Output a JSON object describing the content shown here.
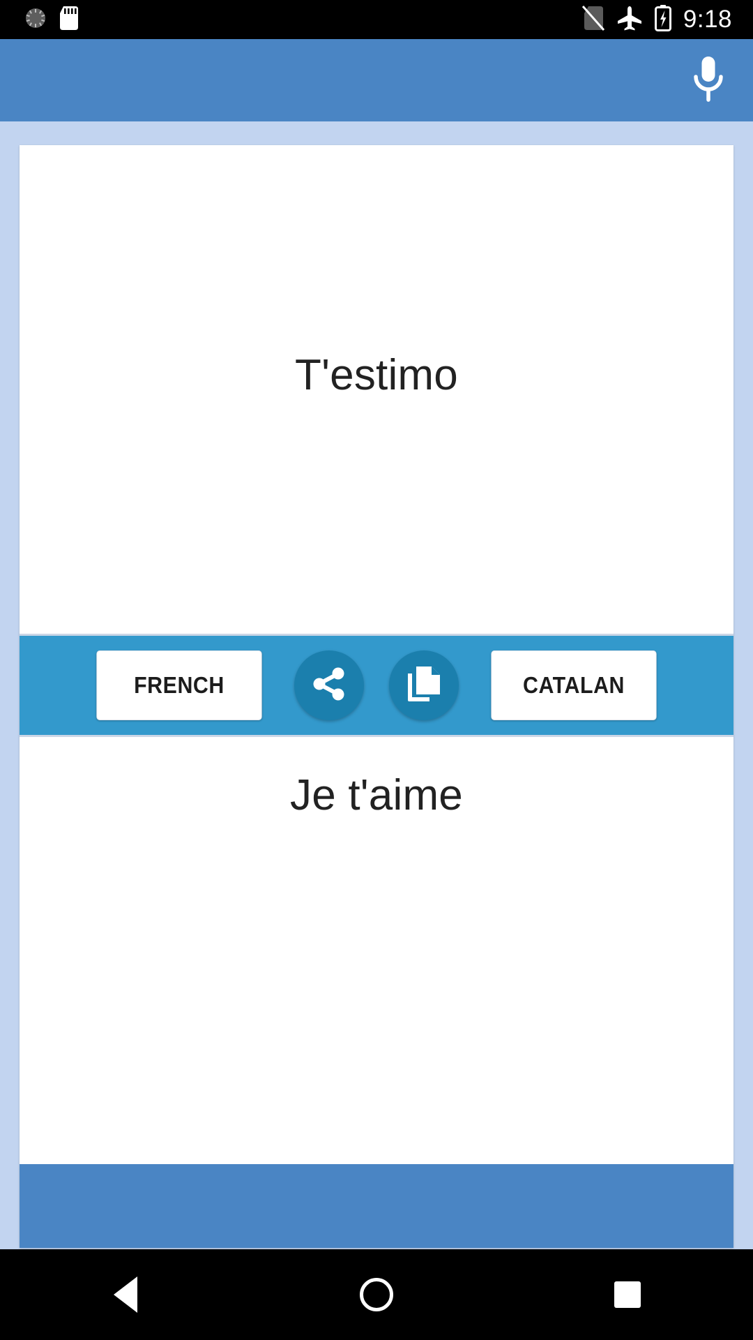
{
  "status_bar": {
    "time": "9:18",
    "left_icons": [
      {
        "name": "dnd-dial-icon",
        "label": ""
      },
      {
        "name": "sd-card-icon",
        "label": ""
      }
    ],
    "right_icons": [
      {
        "name": "no-sim-icon",
        "label": ""
      },
      {
        "name": "airplane-mode-icon",
        "label": ""
      },
      {
        "name": "battery-charging-icon",
        "label": ""
      }
    ]
  },
  "app_bar": {
    "title": "",
    "mic_icon": "microphone-icon"
  },
  "translation": {
    "source_text": "T'estimo",
    "target_text": "Je t'aime"
  },
  "toolbar": {
    "source_language_label": "FRENCH",
    "target_language_label": "CATALAN",
    "share_icon": "share-icon",
    "copy_icon": "copy-icon"
  },
  "nav_bar": {
    "back_label": "Back",
    "home_label": "Home",
    "recents_label": "Recents"
  },
  "colors": {
    "app_bar": "#4a85c4",
    "page_background": "#c2d4f0",
    "toolbar_band": "#3399cc",
    "round_button": "#1b7fad",
    "card": "#ffffff",
    "text": "#222222"
  }
}
